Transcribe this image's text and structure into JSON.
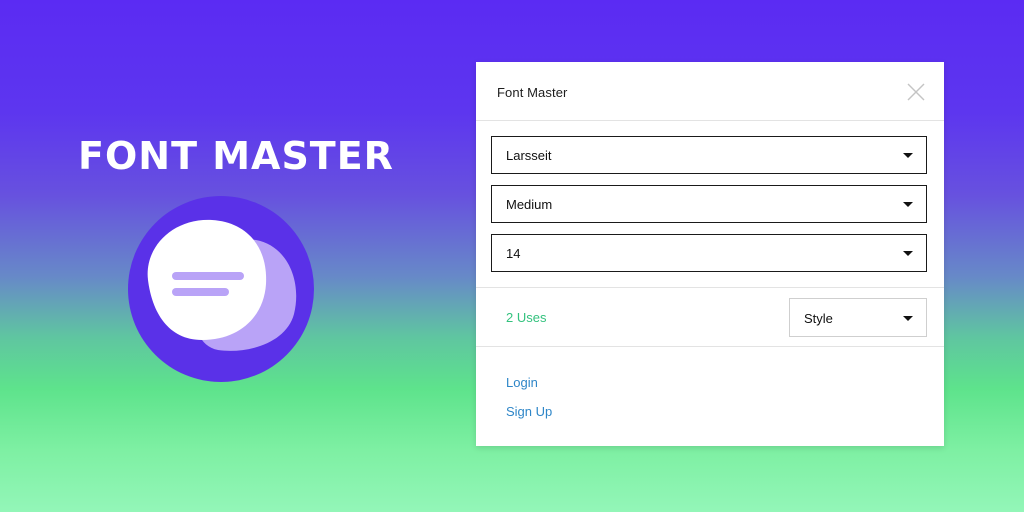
{
  "hero": {
    "title": "FONT MASTER"
  },
  "logo": {
    "icon": "text-bubble-icon",
    "colors": {
      "circle": "#5a31e8",
      "back_blob": "#b9a3f7",
      "front_blob": "#ffffff",
      "lines": "#b9a3f7"
    }
  },
  "panel": {
    "title": "Font Master",
    "close_icon": "close-icon",
    "font_family": {
      "value": "Larsseit"
    },
    "font_weight": {
      "value": "Medium"
    },
    "font_size": {
      "value": "14"
    },
    "uses": "2 Uses",
    "style_select": {
      "value": "Style"
    },
    "links": {
      "login": "Login",
      "signup": "Sign Up"
    }
  },
  "colors": {
    "uses_green": "#33c27e",
    "link_blue": "#2e86c8",
    "gradient_top": "#5b2bf3",
    "gradient_bottom": "#93f6b8"
  }
}
